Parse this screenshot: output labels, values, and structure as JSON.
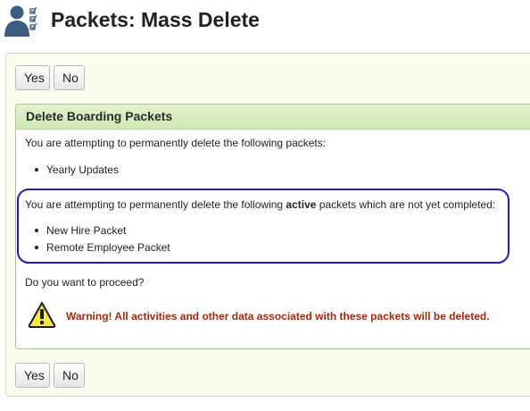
{
  "header": {
    "title": "Packets: Mass Delete",
    "icon": "user-checklist-icon"
  },
  "top_buttons": {
    "yes_label": "Yes",
    "no_label": "No"
  },
  "bottom_buttons": {
    "yes_label": "Yes",
    "no_label": "No"
  },
  "panel": {
    "title": "Delete Boarding Packets",
    "intro": "You are attempting to permanently delete the following packets:",
    "packets": [
      "Yearly Updates"
    ],
    "active_intro_before": "You are attempting to permanently delete the following ",
    "active_word": "active",
    "active_intro_after": " packets which are not yet completed:",
    "active_packets": [
      "New Hire Packet",
      "Remote Employee Packet"
    ],
    "question": "Do you want to proceed?",
    "warning_icon": "warning-triangle-icon",
    "warning": "Warning! All activities and other data associated with these packets will be deleted."
  },
  "colors": {
    "warning_text": "#9e2b10",
    "highlight_border": "#1f1fb0",
    "panel_header": "#d8ecbf"
  }
}
